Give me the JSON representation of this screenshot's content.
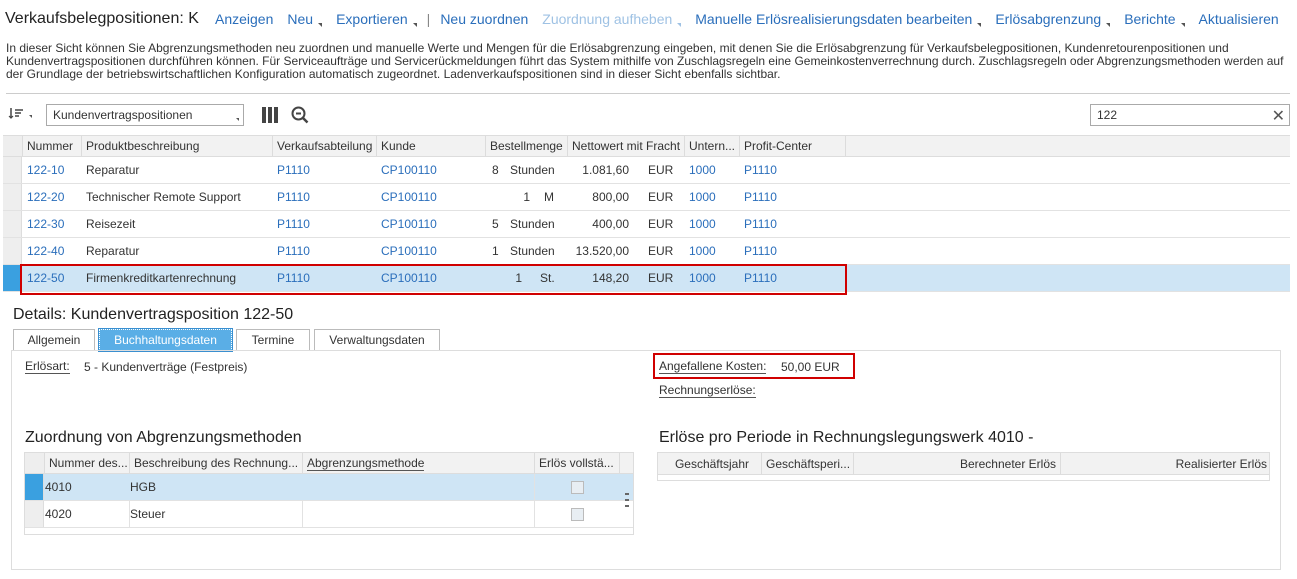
{
  "toolbar": {
    "title": "Verkaufsbelegpositionen: K",
    "items": [
      {
        "label": "Anzeigen"
      },
      {
        "label": "Neu"
      },
      {
        "label": "Exportieren"
      },
      {
        "label": "Neu zuordnen"
      },
      {
        "label": "Zuordnung aufheben"
      },
      {
        "label": "Manuelle Erlösrealisierungsdaten bearbeiten"
      },
      {
        "label": "Erlösabgrenzung"
      },
      {
        "label": "Berichte"
      },
      {
        "label": "Aktualisieren"
      }
    ]
  },
  "intro": "In dieser Sicht können Sie Abgrenzungsmethoden neu zuordnen und manuelle Werte und Mengen für die Erlösabgrenzung eingeben, mit denen Sie die Erlösabgrenzung für Verkaufsbelegpositionen, Kundenretourenpositionen und Kundenvertragspositionen durchführen können. Für Serviceaufträge und Servicerückmeldungen führt das System mithilfe von Zuschlagsregeln eine Gemeinkostenverrechnung durch. Zuschlagsregeln oder Abgrenzungsmethoden werden auf der Grundlage der betriebswirtschaftlichen Konfiguration automatisch zugeordnet. Ladenverkaufspositionen sind in dieser Sicht ebenfalls sichtbar.",
  "list": {
    "view": "Kundenvertragspositionen",
    "search_value": "122",
    "columns": [
      "Nummer",
      "Produktbeschreibung",
      "Verkaufsabteilung",
      "Kunde",
      "Bestellmenge",
      "Nettowert mit Fracht",
      "Untern...",
      "Profit-Center"
    ],
    "rows": [
      {
        "nummer": "122-10",
        "beschreibung": "Reparatur",
        "abteilung": "P1110",
        "kunde": "CP100110",
        "menge": "8",
        "einheit": "Stunden",
        "wert": "1.081,60",
        "waehrung": "EUR",
        "untern": "1000",
        "pc": "P1110"
      },
      {
        "nummer": "122-20",
        "beschreibung": "Technischer Remote Support",
        "abteilung": "P1110",
        "kunde": "CP100110",
        "menge": "1",
        "einheit": "M",
        "wert": "800,00",
        "waehrung": "EUR",
        "untern": "1000",
        "pc": "P1110"
      },
      {
        "nummer": "122-30",
        "beschreibung": "Reisezeit",
        "abteilung": "P1110",
        "kunde": "CP100110",
        "menge": "5",
        "einheit": "Stunden",
        "wert": "400,00",
        "waehrung": "EUR",
        "untern": "1000",
        "pc": "P1110"
      },
      {
        "nummer": "122-40",
        "beschreibung": "Reparatur",
        "abteilung": "P1110",
        "kunde": "CP100110",
        "menge": "1",
        "einheit": "Stunden",
        "wert": "13.520,00",
        "waehrung": "EUR",
        "untern": "1000",
        "pc": "P1110"
      },
      {
        "nummer": "122-50",
        "beschreibung": "Firmenkreditkartenrechnung",
        "abteilung": "P1110",
        "kunde": "CP100110",
        "menge": "1",
        "einheit": "St.",
        "wert": "148,20",
        "waehrung": "EUR",
        "untern": "1000",
        "pc": "P1110"
      }
    ]
  },
  "details": {
    "title": "Details: Kundenvertragsposition 122-50",
    "tabs": [
      "Allgemein",
      "Buchhaltungsdaten",
      "Termine",
      "Verwaltungsdaten"
    ],
    "erloesart_label": "Erlösart:",
    "erloesart_value": "5 - Kundenverträge (Festpreis)",
    "kosten_label": "Angefallene Kosten:",
    "kosten_value": "50,00 EUR",
    "rechnungserloese_label": "Rechnungserlöse:",
    "methods": {
      "title": "Zuordnung von Abgrenzungsmethoden",
      "columns": [
        "Nummer des...",
        "Beschreibung des Rechnung...",
        "Abgrenzungsmethode",
        "Erlös vollstä..."
      ],
      "rows": [
        {
          "nummer": "4010",
          "beschreibung": "HGB"
        },
        {
          "nummer": "4020",
          "beschreibung": "Steuer"
        }
      ]
    },
    "periods": {
      "title": "Erlöse pro Periode in Rechnungslegungswerk 4010 -",
      "columns": [
        "Geschäftsjahr",
        "Geschäftsperi...",
        "Berechneter Erlös",
        "Realisierter Erlös"
      ]
    }
  }
}
